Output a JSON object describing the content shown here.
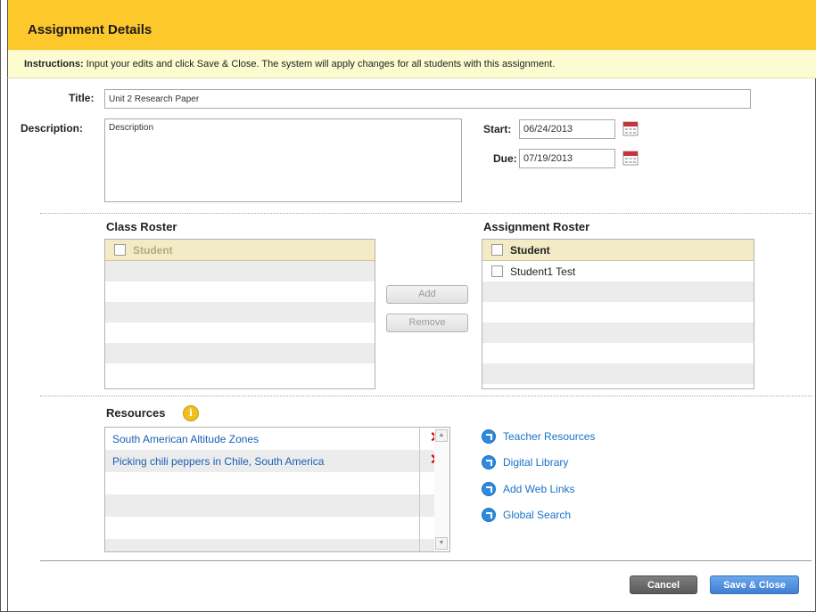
{
  "header": {
    "title": "Assignment Details"
  },
  "instructions": {
    "label": "Instructions:",
    "text": " Input your edits and click Save & Close. The system will apply changes for all students with this assignment."
  },
  "form": {
    "title_label": "Title:",
    "title_value": "Unit 2 Research Paper",
    "description_label": "Description:",
    "description_value": "Description",
    "start_label": "Start:",
    "start_value": "06/24/2013",
    "due_label": "Due:",
    "due_value": "07/19/2013"
  },
  "class_roster": {
    "title": "Class Roster",
    "column": "Student",
    "rows": [
      "",
      "",
      "",
      "",
      "",
      ""
    ]
  },
  "assignment_roster": {
    "title": "Assignment Roster",
    "column": "Student",
    "rows": [
      "Student1 Test",
      "",
      "",
      "",
      "",
      ""
    ]
  },
  "actions": {
    "add_label": "Add",
    "remove_label": "Remove"
  },
  "resources": {
    "title": "Resources",
    "info_glyph": "i",
    "items": [
      "South American Altitude Zones",
      "Picking chili peppers in Chile, South America"
    ],
    "delete_glyph": "✕",
    "links": [
      "Teacher Resources",
      "Digital Library",
      "Add Web Links",
      "Global Search"
    ]
  },
  "footer": {
    "cancel_label": "Cancel",
    "save_label": "Save & Close"
  },
  "colors": {
    "header_bg": "#fcc82c",
    "instructions_bg": "#fdfbd0",
    "link": "#1a73c8",
    "delete": "#d40000"
  }
}
